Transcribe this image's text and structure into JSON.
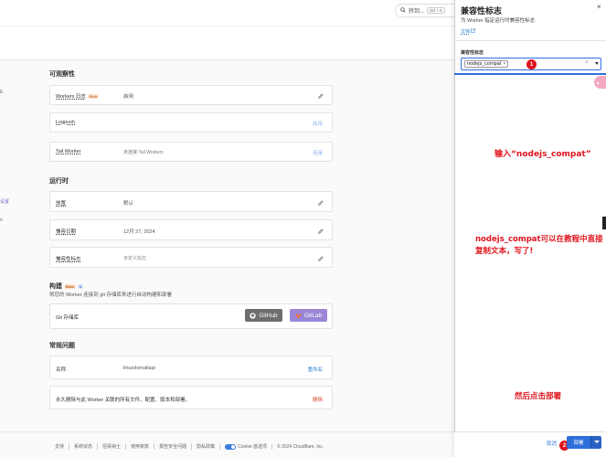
{
  "search": {
    "label": "转到...",
    "shortcut": "ctrl + K"
  },
  "left_fragments": [
    "E",
    "设置",
    "n"
  ],
  "observability": {
    "title": "可观察性",
    "rows": [
      {
        "key": "Workers 日志",
        "badge": "Beta",
        "value": "启用",
        "action": ""
      },
      {
        "key": "Logpush",
        "value": "",
        "action": "启用"
      },
      {
        "key": "Tail Worker",
        "value": "未连接 Tail Workers",
        "action": "连接"
      }
    ]
  },
  "runtime": {
    "title": "运行时",
    "rows": [
      {
        "key": "放置",
        "value": "默认"
      },
      {
        "key": "兼容日期",
        "value": "12月 27, 2024"
      },
      {
        "key": "兼容性标志",
        "value": "未定义标志"
      }
    ]
  },
  "build": {
    "title": "构建",
    "badge": "Beta",
    "badge_num": "3",
    "subtitle": "将您的 Worker 连接到 git 存储库来进行自动构建和部署",
    "repo_label": "Git 存储库",
    "github_label": "GitHub",
    "gitlab_label": "GitLab"
  },
  "general": {
    "title": "常规问题",
    "rows": [
      {
        "key": "名称",
        "value": "linuxdomailapi",
        "action": "重命名"
      },
      {
        "key": "永久删除与此 Worker 关联的所有文件、配置、版本和部署。",
        "value": "",
        "action": "删除"
      }
    ]
  },
  "footer": {
    "links": [
      "支持",
      "系统状态",
      "招贤纳士",
      "使用条款",
      "报告安全问题",
      "隐私政策"
    ],
    "cookie_label": "Cookie 首选项",
    "copyright": "© 2024 Cloudflare, Inc."
  },
  "drawer": {
    "title": "兼容性标志",
    "close": "×",
    "description": "为 Worker 指定运行时兼容性标志",
    "docs_label": "文档",
    "field_label": "兼容性标志",
    "chip": "nodejs_compat",
    "chip_remove": "×",
    "clear": "×",
    "cancel_label": "取消",
    "deploy_label": "部署",
    "float_label": "▶",
    "colors": {
      "accent": "#2f6fdc",
      "annotation": "#e0141d"
    }
  },
  "annotations": {
    "marker1": "1",
    "marker2": "2",
    "text1": "输入“nodejs_compat”",
    "text2": "nodejs_compat可以在教程中直接复制文本，写了!",
    "text3": "然后点击部署"
  }
}
